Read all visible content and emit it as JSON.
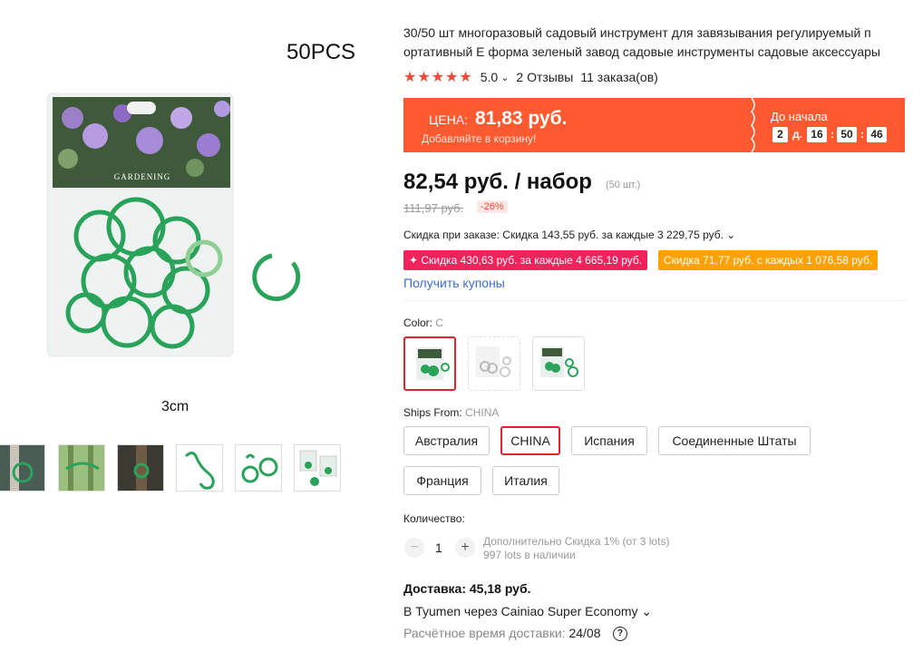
{
  "gallery": {
    "overlay_count": "50PCS",
    "overlay_size": "3cm",
    "package_brand": "GARDENING",
    "thumbnails": [
      "thumb-1",
      "thumb-2",
      "thumb-3",
      "thumb-4",
      "thumb-5",
      "thumb-6"
    ]
  },
  "product": {
    "title": "30/50 шт многоразовый садовый инструмент для завязывания регулируемый п ортативный Е форма зеленый завод садовые инструменты садовые аксессуары",
    "rating": "5.0",
    "rating_stars": 5,
    "reviews": "2 Отзывы",
    "orders": "11 заказа(ов)"
  },
  "promo": {
    "price_label": "ЦЕНА:",
    "price": "81,83 руб.",
    "sub": "Добавляйте в корзину!",
    "timer_title": "До начала",
    "days": "2",
    "days_unit": "д.",
    "hours": "16",
    "minutes": "50",
    "seconds": "46"
  },
  "pricing": {
    "price": "82,54 руб. / набор",
    "lot": "(50 шт.)",
    "old_price": "111,97 руб.",
    "discount": "-26%",
    "order_discount": "Скидка при заказе: Скидка 143,55 руб. за каждые 3 229,75 руб. ⌄",
    "coupon_1": "✦ Скидка 430,63 руб. за каждые 4 665,19 руб.",
    "coupon_2": "Скидка 71,77 руб. с каждых 1 076,58 руб.",
    "get_coupons": "Получить купоны"
  },
  "color": {
    "label": "Color:",
    "value": "C",
    "options": [
      "A",
      "B",
      "C"
    ]
  },
  "shipping": {
    "label": "Ships From:",
    "value": "CHINA",
    "options": [
      "Австралия",
      "CHINA",
      "Испания",
      "Соединенные Штаты",
      "Франция",
      "Италия"
    ]
  },
  "quantity": {
    "label": "Количество:",
    "minus": "−",
    "plus": "+",
    "value": "1",
    "extra": "Дополнительно Скидка 1% (от 3 lots)",
    "stock": "997 lots в наличии"
  },
  "delivery": {
    "title": "Доставка: 45,18 руб.",
    "route": "В Tyumen через Cainiao Super Economy ⌄",
    "eta_label": "Расчётное время доставки:",
    "eta_value": "24/08",
    "help": "?"
  },
  "colors": {
    "accent_red": "#e2232d",
    "promo_orange": "#fd5a31",
    "coupon_pink": "#f0235c",
    "coupon_orange": "#ffa200",
    "link_blue": "#3b6ec9",
    "product_green": "#2aa35a"
  }
}
